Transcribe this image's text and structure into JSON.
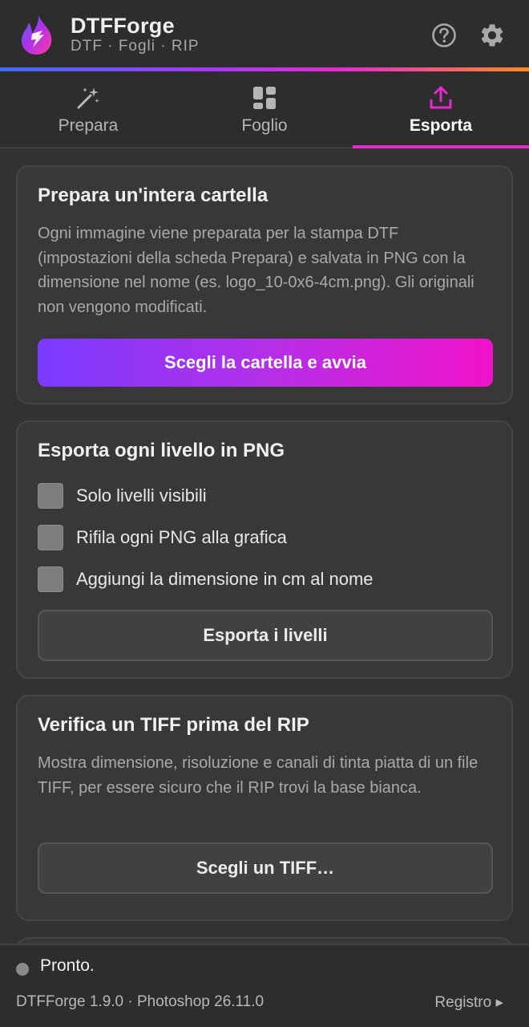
{
  "header": {
    "title": "DTFForge",
    "subtitle": "DTF · Fogli · RIP",
    "help_icon": "help-circle-icon",
    "settings_icon": "gear-icon"
  },
  "tabs": [
    {
      "label": "Prepara",
      "icon": "magic-wand-icon",
      "active": false
    },
    {
      "label": "Foglio",
      "icon": "grid-layout-icon",
      "active": false
    },
    {
      "label": "Esporta",
      "icon": "upload-icon",
      "active": true
    }
  ],
  "cards": {
    "folder": {
      "title": "Prepara un'intera cartella",
      "description": "Ogni immagine viene preparata per la stampa DTF (impostazioni della scheda Prepara) e salvata in PNG con la dimensione nel nome (es. logo_10-0x6-4cm.png). Gli originali non vengono modificati.",
      "button": "Scegli la cartella e avvia"
    },
    "layers": {
      "title": "Esporta ogni livello in PNG",
      "options": [
        {
          "label": "Solo livelli visibili",
          "checked": false
        },
        {
          "label": "Rifila ogni PNG alla grafica",
          "checked": false
        },
        {
          "label": "Aggiungi la dimensione in cm al nome",
          "checked": false
        }
      ],
      "button": "Esporta i livelli"
    },
    "tiff": {
      "title": "Verifica un TIFF prima del RIP",
      "description": "Mostra dimensione, risoluzione e canali di tinta piatta di un file TIFF, per essere sicuro che il RIP trovi la base bianca.",
      "button": "Scegli un TIFF…"
    }
  },
  "status": {
    "text": "Pronto.",
    "version": "DTFForge 1.9.0 · Photoshop 26.11.0",
    "log_link": "Registro ▸"
  },
  "colors": {
    "accent": "#e52bd0",
    "gradient_start": "#7a3bff",
    "gradient_end": "#f012c9",
    "background": "#323232"
  }
}
